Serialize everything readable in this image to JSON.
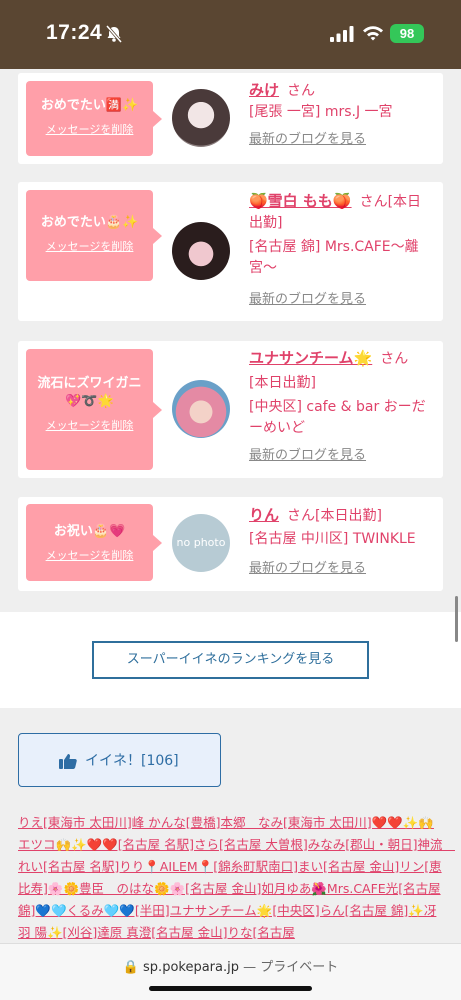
{
  "status": {
    "time": "17:24",
    "battery": "98"
  },
  "cards": [
    {
      "message": "おめでたい🈵✨",
      "delete": "メッセージを削除",
      "name": "みけ",
      "san": "さん",
      "lines": [
        "[尾張 一宮] mrs.J 一宮"
      ],
      "blog": "最新のブログを見る"
    },
    {
      "message": "おめでたい🎂✨",
      "delete": "メッセージを削除",
      "name": "🍑雪白 もも🍑",
      "san": "さん[本日出勤]",
      "lines": [
        "[名古屋 錦] Mrs.CAFE〜離宮〜"
      ],
      "blog": "最新のブログを見る"
    },
    {
      "message": "流石にズワイガニ💖➰🌟",
      "delete": "メッセージを削除",
      "name": "ユナサンチーム🌟",
      "san": "さん",
      "lines": [
        "[本日出勤]",
        "[中央区] cafe & bar おーだーめいど"
      ],
      "blog": "最新のブログを見る"
    },
    {
      "message": "お祝い🎂💗",
      "delete": "メッセージを削除",
      "name": "りん",
      "san": "さん[本日出勤]",
      "lines": [
        "[名古屋 中川区] TWINKLE"
      ],
      "blog": "最新のブログを見る",
      "avatar_text": "no photo"
    }
  ],
  "ranking_button": "スーパーイイネのランキングを見る",
  "like_button": {
    "label": "イイネ！[106]",
    "icon": "thumbs-up-icon"
  },
  "likers_text": "りえ[東海市 太田川]峰 かんな[豊橋]本郷　なみ[東海市 太田川]❤️❤️✨🙌エツコ🙌✨❤️❤️[名古屋 名駅]さら[名古屋 大曽根]みなみ[郡山・朝日]神流　れい[名古屋 名駅]りり📍AILEM📍[錦糸町駅南口]まい[名古屋 金山]リン[恵比寿]🌸🌼豊臣　のはな🌼🌸[名古屋 金山]如月ゆあ🌺Mrs.CAFE光[名古屋 錦]💙🩵くるみ🩵💙[半田]ユナサンチーム🌟[中央区]らん[名古屋 錦]✨冴羽 陽✨[刈谷]達原 真澄[名古屋 金山]りな[名古屋",
  "url_bar": {
    "domain": "sp.pokepara.jp",
    "separator": "—",
    "mode": "プライベート"
  },
  "colors": {
    "accent_pink": "#e0426a",
    "bubble_pink": "#ff9fa9",
    "brand_brown": "#5a4632",
    "link_blue": "#2f6f9c"
  }
}
